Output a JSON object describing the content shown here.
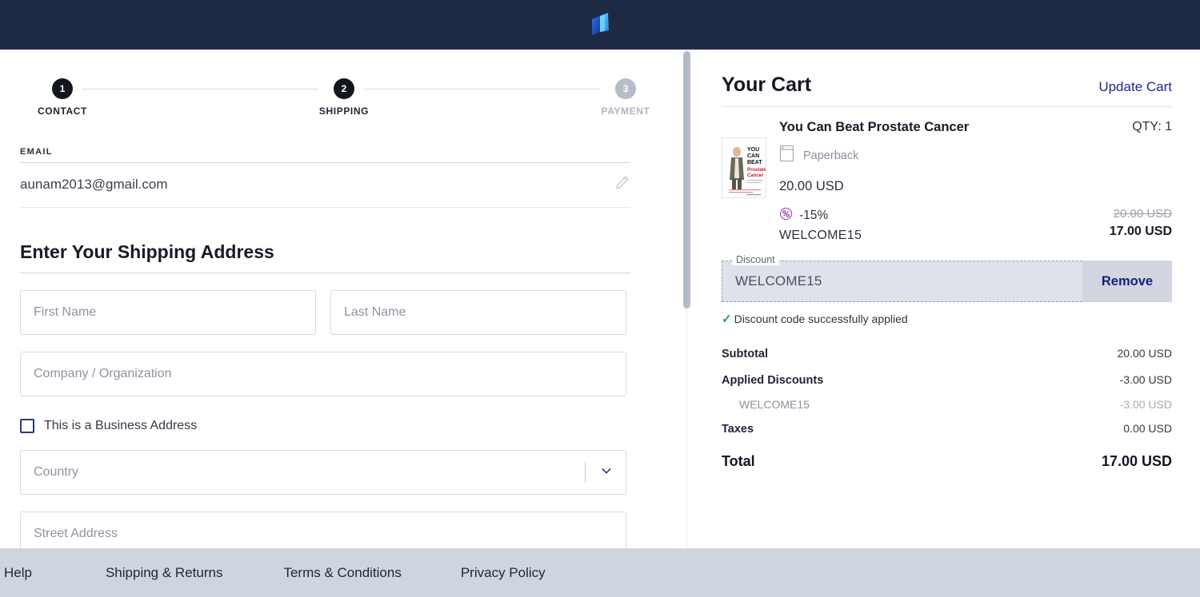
{
  "header": {
    "logo_icon": "open-book-logo"
  },
  "stepper": {
    "steps": [
      {
        "num": "1",
        "label": "CONTACT",
        "state": "active"
      },
      {
        "num": "2",
        "label": "SHIPPING",
        "state": "active"
      },
      {
        "num": "3",
        "label": "PAYMENT",
        "state": "inactive"
      }
    ]
  },
  "contact": {
    "email_label": "EMAIL",
    "email_value": "aunam2013@gmail.com",
    "edit_icon": "pencil-icon"
  },
  "shipping": {
    "heading": "Enter Your Shipping Address",
    "first_name_placeholder": "First Name",
    "last_name_placeholder": "Last Name",
    "company_placeholder": "Company / Organization",
    "business_checkbox_label": "This is a Business Address",
    "business_checkbox_checked": false,
    "country_placeholder": "Country",
    "street_placeholder": "Street Address"
  },
  "cart": {
    "title": "Your Cart",
    "update_link": "Update Cart",
    "item": {
      "name": "You Can Beat Prostate Cancer",
      "qty": "QTY: 1",
      "format": "Paperback",
      "format_icon": "book-icon",
      "price": "20.00 USD",
      "discount_icon": "percent-icon",
      "discount_percent": "-15%",
      "discount_code": "WELCOME15",
      "price_original": "20.00 USD",
      "price_discounted": "17.00 USD"
    },
    "discount": {
      "legend": "Discount",
      "value": "WELCOME15",
      "remove_label": "Remove",
      "success_message": "Discount code successfully applied",
      "success_icon": "check-icon"
    },
    "totals": [
      {
        "label": "Subtotal",
        "value": "20.00 USD",
        "kind": "normal"
      },
      {
        "label": "Applied Discounts",
        "value": "-3.00 USD",
        "kind": "normal"
      },
      {
        "label": "WELCOME15",
        "value": "-3.00 USD",
        "kind": "sub"
      },
      {
        "label": "Taxes",
        "value": "0.00 USD",
        "kind": "normal"
      }
    ],
    "grand_total": {
      "label": "Total",
      "value": "17.00 USD"
    }
  },
  "footer": {
    "links": [
      "Help",
      "Shipping & Returns",
      "Terms & Conditions",
      "Privacy Policy"
    ]
  },
  "colors": {
    "header_bg": "#1e2a44",
    "footer_bg": "#ced4e0",
    "link_blue": "#1b2a8f",
    "success_green": "#19a463",
    "discount_purple": "#9a4fa8",
    "step_active": "#14161f",
    "step_inactive": "#b8bcc9"
  }
}
